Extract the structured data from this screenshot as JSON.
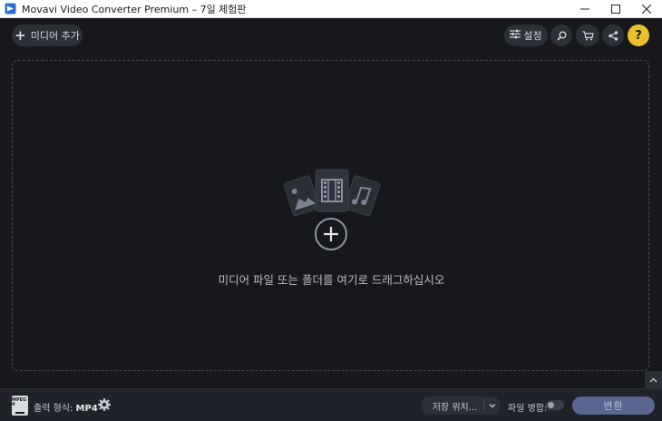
{
  "window": {
    "title": "Movavi Video Converter Premium – 7일 체험판",
    "icon": "movavi-logo-icon",
    "controls": [
      "minimize-icon",
      "maximize-icon",
      "close-icon"
    ]
  },
  "toolbar": {
    "add_media_label": "미디어 추가",
    "settings_label": "설정",
    "help_label": "?",
    "icons": [
      "plus-icon",
      "sliders-icon",
      "search-icon",
      "cart-icon",
      "share-icon",
      "help-icon"
    ]
  },
  "dropzone": {
    "hint": "미디어 파일 또는 폴더를 여기로 드래그하십시오"
  },
  "bottombar": {
    "format_icon_text": "MPEG 4",
    "output_format_label": "출력 형식:",
    "output_format_value": "MP4",
    "save_location_label": "저장 위치...",
    "merge_label": "파일 병합:",
    "merge_enabled": false,
    "convert_label": "변환"
  },
  "colors": {
    "background": "#16181c",
    "button_bg": "#2b2f36",
    "help_accent": "#e8c22a",
    "convert_bg": "#5b6590"
  }
}
